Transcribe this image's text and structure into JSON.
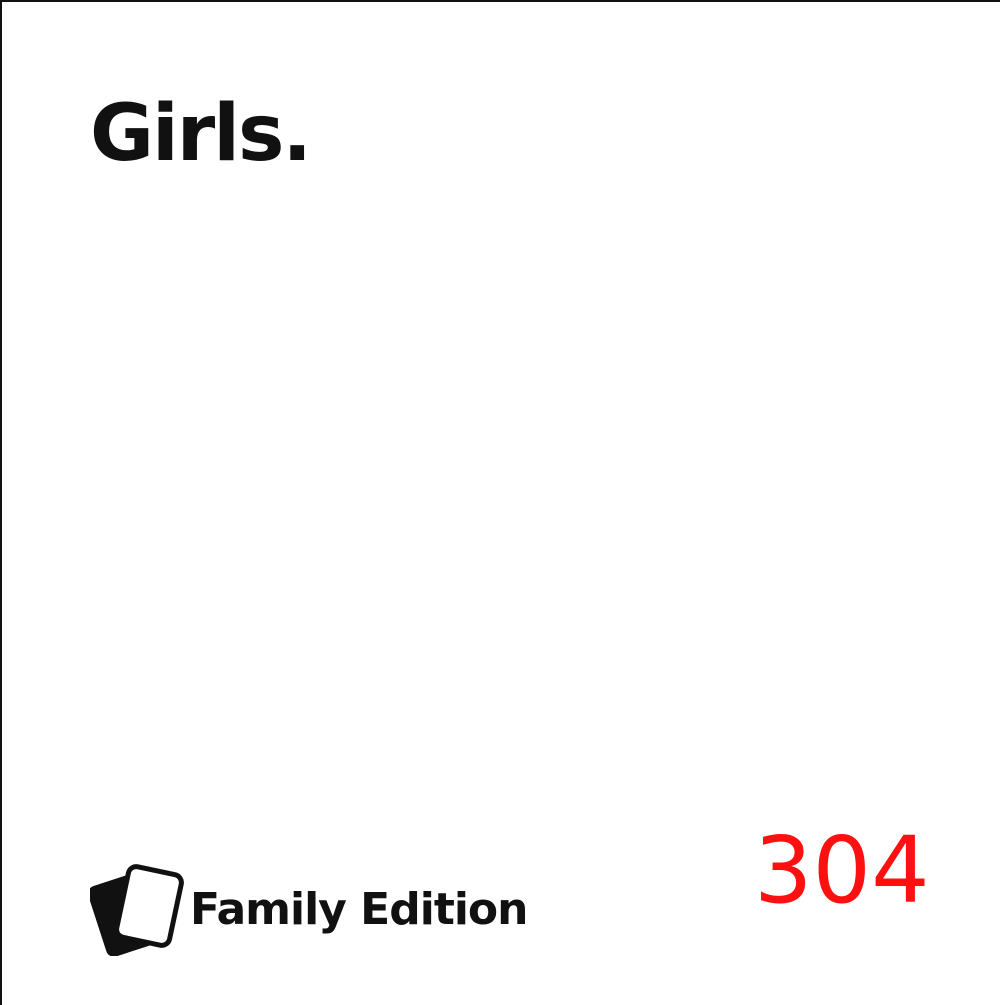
{
  "card": {
    "text": "Girls.",
    "brand_name": "Family Edition",
    "logo": "cards-logo-icon",
    "number": "304",
    "colors": {
      "text": "#111111",
      "background": "#ffffff",
      "number": "#ff1010"
    }
  }
}
